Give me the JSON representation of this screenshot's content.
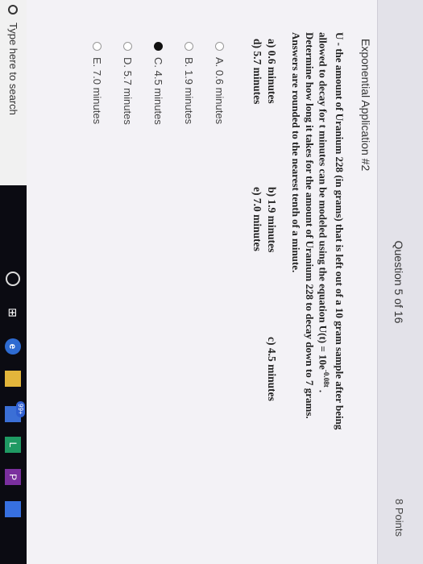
{
  "header": {
    "question_label": "Question 5 of 16",
    "points": "8 Points"
  },
  "section_title": "Exponential Application #2",
  "question": {
    "line1": "U - the amount of Uranium 228 (in grams) that is left out of a 10 gram sample after being",
    "line2": "allowed to decay for t minutes can be modeled using the equation U(t) = 10e",
    "exponent": "-0.08t",
    "line3": "Determine how long it takes for the amount of Uranium 228 to decay down to 7 grams.",
    "line4": "Answers are rounded to the nearest tenth of a minute."
  },
  "printed_answers": {
    "a": "a) 0.6 minutes",
    "b": "b) 1.9 minutes",
    "c": "c) 4.5 minutes",
    "d": "d) 5.7 minutes",
    "e": "e) 7.0 minutes"
  },
  "options": [
    {
      "label": "A. 0.6 minutes",
      "selected": false
    },
    {
      "label": "B. 1.9 minutes",
      "selected": false
    },
    {
      "label": "C. 4.5 minutes",
      "selected": true
    },
    {
      "label": "D. 5.7 minutes",
      "selected": false
    },
    {
      "label": "E. 7.0 minutes",
      "selected": false
    }
  ],
  "taskbar": {
    "search_placeholder": "Type here to search",
    "taskview_glyph": "⊞",
    "mail_badge": "99+"
  }
}
